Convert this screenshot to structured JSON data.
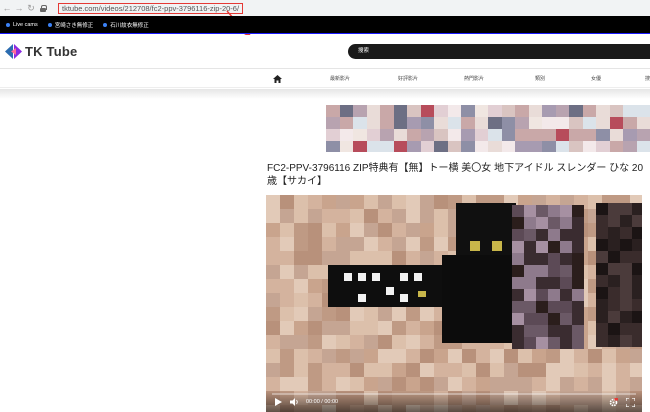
{
  "browser": {
    "url": "tktube.com/videos/212708/fc2-ppv-3796116-zip-20-6/"
  },
  "bookmarks": [
    {
      "label": "Live cams"
    },
    {
      "label": "宮崎さき無修正"
    },
    {
      "label": "石川紋衣無修正"
    }
  ],
  "site": {
    "logo_text": "TK Tube",
    "search_label": "搜索"
  },
  "nav": {
    "items": [
      "最新影片",
      "好評影片",
      "熱門影片",
      "類別",
      "女優",
      "搜"
    ]
  },
  "video": {
    "title": "FC2-PPV-3796116 ZIP特典有【無】トー横 美〇女 地下アイドル スレンダー ひな 20歳【サカイ】",
    "time_display": "00:00 / 00:00"
  },
  "colors": {
    "annotation_red": "#e53935",
    "bookmark_bar": "#000000",
    "search_bg": "#1a1a1a",
    "logo_accent": "#8a2be2"
  }
}
